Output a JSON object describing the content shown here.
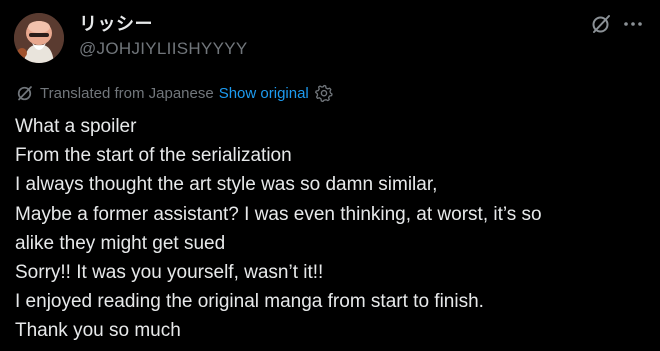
{
  "author": {
    "display_name": "リッシー",
    "handle": "@JOHJIYLIISHYYYY",
    "avatar_icon": "avatar-illustration"
  },
  "header_actions": {
    "grok_icon": "grok-icon",
    "more_icon": "more-options-icon"
  },
  "translation": {
    "icon": "translate-icon",
    "label": "Translated from Japanese",
    "show_original": "Show original",
    "settings_icon": "gear-icon"
  },
  "tweet_lines": [
    "What a spoiler",
    "From the start of the serialization",
    "I always thought the art style was so damn similar,",
    "Maybe a former assistant? I was even thinking, at worst, it’s so",
    "alike they might get sued",
    "Sorry!! It was you yourself, wasn’t it!!",
    "I enjoyed reading the original manga from start to finish.",
    "Thank you so much"
  ],
  "colors": {
    "background": "#000000",
    "primary_text": "#e7e9ea",
    "secondary_text": "#71767b",
    "link": "#1d9bf0"
  }
}
